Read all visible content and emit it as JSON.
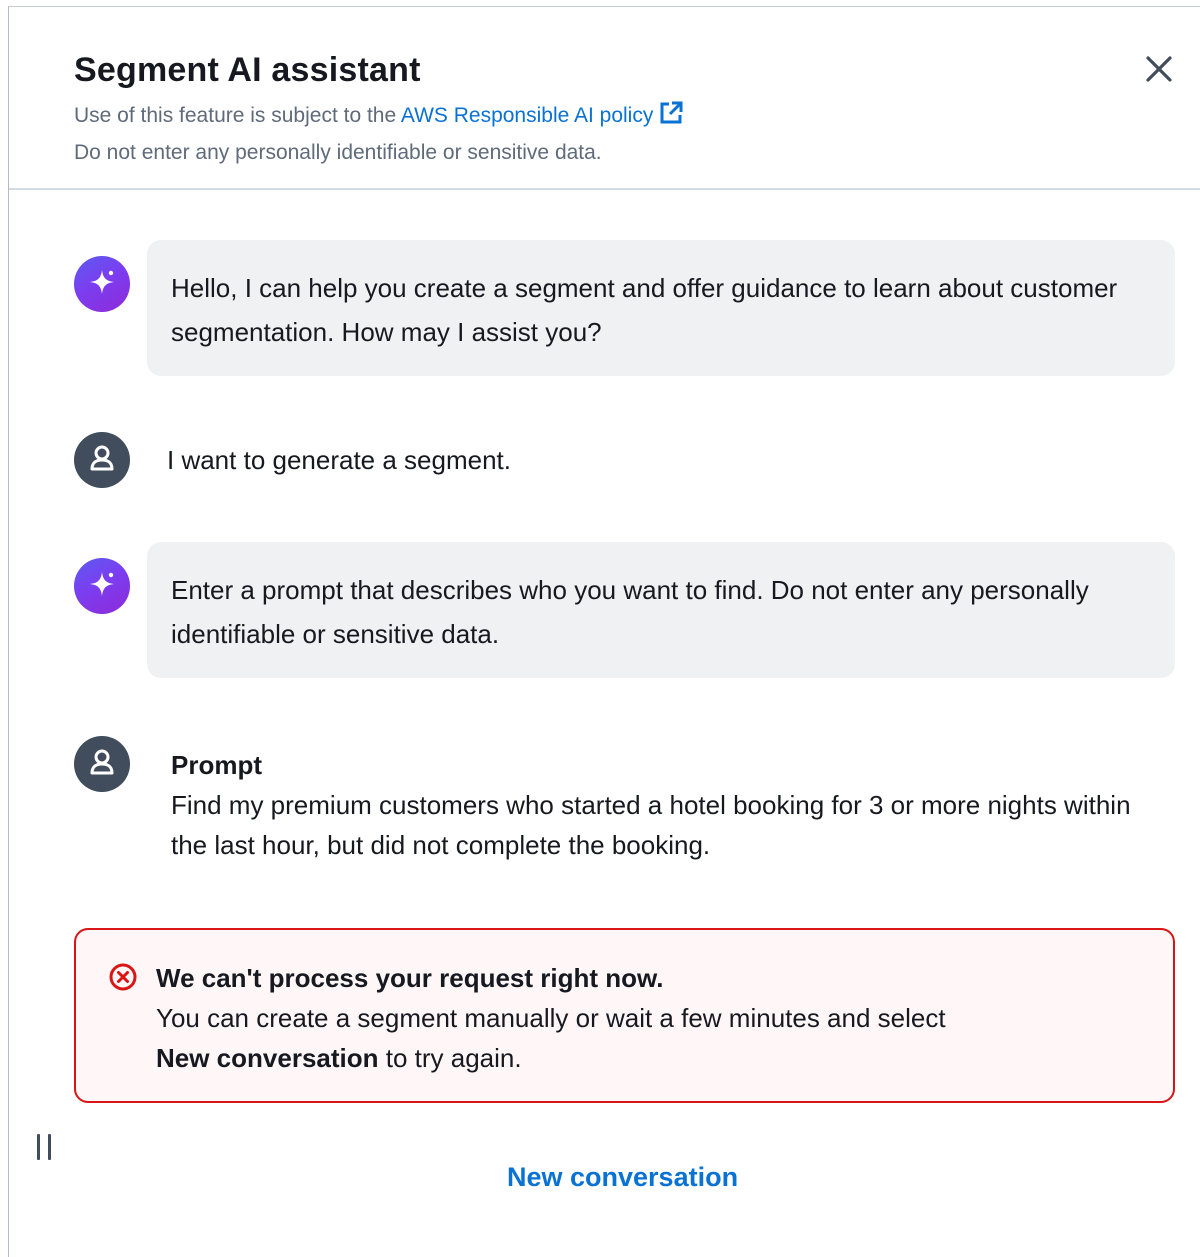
{
  "header": {
    "title": "Segment AI assistant",
    "subtitle_prefix": "Use of this feature is subject to the ",
    "policy_link": "AWS Responsible AI policy",
    "subtitle_line2": "Do not enter any personally identifiable or sensitive data."
  },
  "messages": [
    {
      "role": "assistant",
      "text": "Hello, I can help you create a segment and offer guidance to learn about customer segmentation. How may I assist you?"
    },
    {
      "role": "user",
      "text": "I want to generate a segment."
    },
    {
      "role": "assistant",
      "text": "Enter a prompt that describes who you want to find. Do not enter any personally identifiable or sensitive data."
    },
    {
      "role": "user",
      "label": "Prompt",
      "text": "Find my premium customers who started a hotel booking for 3 or more nights within the last hour, but did not complete the booking."
    }
  ],
  "alert": {
    "title": "We can't process your request right now.",
    "body_prefix": "You can create a segment manually or wait a few minutes and select",
    "body_emphasis": "New conversation",
    "body_suffix": " to try again."
  },
  "footer": {
    "new_conversation": "New conversation"
  },
  "colors": {
    "link": "#0972d3",
    "error": "#d91515",
    "bubble_bg": "#f0f1f2",
    "user_avatar": "#414d5c"
  },
  "icons": [
    "close-icon",
    "external-link-icon",
    "ai-sparkle-icon",
    "user-icon",
    "error-icon",
    "drag-handle-icon"
  ]
}
